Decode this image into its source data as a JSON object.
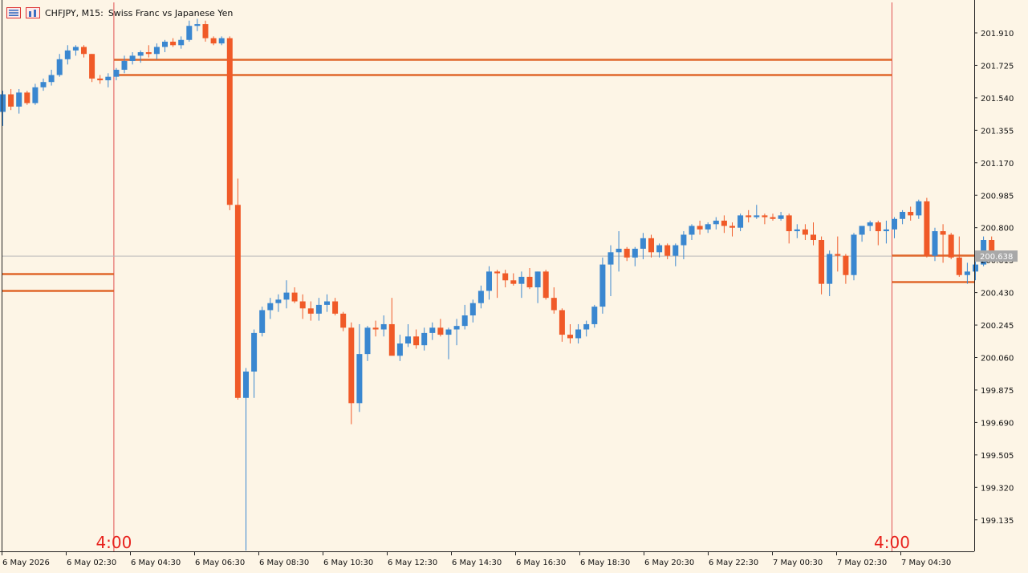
{
  "header": {
    "symbol": "CHFJPY, M15:",
    "description": "Swiss Franc vs Japanese Yen",
    "icons": [
      "menu-list-icon",
      "chart-bars-icon"
    ]
  },
  "chart_data": {
    "type": "candlestick",
    "symbol": "CHFJPY",
    "timeframe": "M15",
    "ylim": [
      199.0,
      202.1
    ],
    "y_ticks": [
      "201.910",
      "201.725",
      "201.540",
      "201.355",
      "201.170",
      "200.985",
      "200.800",
      "200.615",
      "200.430",
      "200.245",
      "200.060",
      "199.875",
      "199.690",
      "199.505",
      "199.320",
      "199.135"
    ],
    "x_ticks": [
      "6 May 2026",
      "6 May 02:30",
      "6 May 04:30",
      "6 May 06:30",
      "6 May 08:30",
      "6 May 10:30",
      "6 May 12:30",
      "6 May 14:30",
      "6 May 16:30",
      "6 May 18:30",
      "6 May 20:30",
      "6 May 22:30",
      "7 May 00:30",
      "7 May 02:30",
      "7 May 04:30"
    ],
    "current_price": "200.638",
    "session_markers": [
      {
        "label": "4:00",
        "bar_index": 14
      },
      {
        "label": "4:00",
        "bar_index": 110
      }
    ],
    "levels": [
      {
        "price": 201.76,
        "from_bar": 14,
        "to_bar": 110
      },
      {
        "price": 201.67,
        "from_bar": 14,
        "to_bar": 110
      },
      {
        "price": 200.54,
        "from_bar": 0,
        "to_bar": 14
      },
      {
        "price": 200.44,
        "from_bar": 0,
        "to_bar": 14
      },
      {
        "price": 200.645,
        "from_bar": 110,
        "to_bar": 121
      },
      {
        "price": 200.49,
        "from_bar": 110,
        "to_bar": 121
      }
    ],
    "colors": {
      "up": "#3a87d0",
      "down": "#f05a28",
      "level": "#e0662a",
      "session": "#e05050",
      "session_label": "#e8231e",
      "background": "#fdf5e6",
      "price_box": "#a8a8a8"
    },
    "candles": [
      [
        201.46,
        201.58,
        201.38,
        201.56
      ],
      [
        201.56,
        201.59,
        201.47,
        201.49
      ],
      [
        201.49,
        201.59,
        201.45,
        201.57
      ],
      [
        201.57,
        201.58,
        201.5,
        201.51
      ],
      [
        201.51,
        201.62,
        201.5,
        201.6
      ],
      [
        201.6,
        201.65,
        201.58,
        201.63
      ],
      [
        201.63,
        201.7,
        201.61,
        201.67
      ],
      [
        201.67,
        201.79,
        201.66,
        201.76
      ],
      [
        201.76,
        201.84,
        201.73,
        201.81
      ],
      [
        201.81,
        201.84,
        201.78,
        201.83
      ],
      [
        201.83,
        201.84,
        201.77,
        201.79
      ],
      [
        201.79,
        201.79,
        201.63,
        201.65
      ],
      [
        201.65,
        201.67,
        201.62,
        201.64
      ],
      [
        201.64,
        201.68,
        201.6,
        201.66
      ],
      [
        201.66,
        201.71,
        201.64,
        201.7
      ],
      [
        201.7,
        201.78,
        201.68,
        201.75
      ],
      [
        201.75,
        201.8,
        201.73,
        201.78
      ],
      [
        201.78,
        201.81,
        201.74,
        201.8
      ],
      [
        201.8,
        201.84,
        201.77,
        201.79
      ],
      [
        201.79,
        201.85,
        201.76,
        201.83
      ],
      [
        201.83,
        201.87,
        201.8,
        201.86
      ],
      [
        201.86,
        201.88,
        201.83,
        201.84
      ],
      [
        201.84,
        201.89,
        201.82,
        201.87
      ],
      [
        201.87,
        201.98,
        201.86,
        201.95
      ],
      [
        201.95,
        201.99,
        201.92,
        201.96
      ],
      [
        201.96,
        201.98,
        201.86,
        201.88
      ],
      [
        201.88,
        201.89,
        201.84,
        201.85
      ],
      [
        201.85,
        201.89,
        201.84,
        201.88
      ],
      [
        201.88,
        201.89,
        200.9,
        200.93
      ],
      [
        200.93,
        201.08,
        199.82,
        199.83
      ],
      [
        199.83,
        200.0,
        198.96,
        199.98
      ],
      [
        199.98,
        200.22,
        199.83,
        200.2
      ],
      [
        200.2,
        200.35,
        200.18,
        200.33
      ],
      [
        200.33,
        200.4,
        200.28,
        200.37
      ],
      [
        200.37,
        200.42,
        200.32,
        200.39
      ],
      [
        200.39,
        200.5,
        200.34,
        200.43
      ],
      [
        200.43,
        200.46,
        200.37,
        200.38
      ],
      [
        200.38,
        200.42,
        200.28,
        200.34
      ],
      [
        200.34,
        200.38,
        200.27,
        200.31
      ],
      [
        200.31,
        200.4,
        200.27,
        200.36
      ],
      [
        200.36,
        200.42,
        200.32,
        200.38
      ],
      [
        200.38,
        200.4,
        200.3,
        200.31
      ],
      [
        200.31,
        200.32,
        200.21,
        200.23
      ],
      [
        200.23,
        200.26,
        199.68,
        199.8
      ],
      [
        199.8,
        200.25,
        199.75,
        200.08
      ],
      [
        200.08,
        200.24,
        200.04,
        200.23
      ],
      [
        200.23,
        200.27,
        200.18,
        200.22
      ],
      [
        200.22,
        200.3,
        200.18,
        200.25
      ],
      [
        200.25,
        200.4,
        200.1,
        200.07
      ],
      [
        200.07,
        200.19,
        200.04,
        200.14
      ],
      [
        200.14,
        200.25,
        200.12,
        200.18
      ],
      [
        200.18,
        200.22,
        200.11,
        200.13
      ],
      [
        200.13,
        200.23,
        200.1,
        200.2
      ],
      [
        200.2,
        200.26,
        200.16,
        200.23
      ],
      [
        200.23,
        200.28,
        200.18,
        200.19
      ],
      [
        200.19,
        200.23,
        200.05,
        200.22
      ],
      [
        200.22,
        200.28,
        200.13,
        200.24
      ],
      [
        200.24,
        200.36,
        200.22,
        200.3
      ],
      [
        200.3,
        200.39,
        200.26,
        200.37
      ],
      [
        200.37,
        200.47,
        200.34,
        200.44
      ],
      [
        200.44,
        200.58,
        200.39,
        200.55
      ],
      [
        200.55,
        200.56,
        200.4,
        200.54
      ],
      [
        200.54,
        200.56,
        200.46,
        200.5
      ],
      [
        200.5,
        200.54,
        200.47,
        200.48
      ],
      [
        200.48,
        200.55,
        200.4,
        200.52
      ],
      [
        200.52,
        200.57,
        200.45,
        200.46
      ],
      [
        200.46,
        200.55,
        200.37,
        200.55
      ],
      [
        200.55,
        200.56,
        200.39,
        200.4
      ],
      [
        200.4,
        200.46,
        200.31,
        200.33
      ],
      [
        200.33,
        200.34,
        200.15,
        200.19
      ],
      [
        200.19,
        200.25,
        200.14,
        200.17
      ],
      [
        200.17,
        200.25,
        200.14,
        200.22
      ],
      [
        200.22,
        200.27,
        200.18,
        200.25
      ],
      [
        200.25,
        200.36,
        200.23,
        200.35
      ],
      [
        200.35,
        200.63,
        200.31,
        200.59
      ],
      [
        200.59,
        200.7,
        200.41,
        200.66
      ],
      [
        200.66,
        200.78,
        200.55,
        200.68
      ],
      [
        200.68,
        200.69,
        200.61,
        200.63
      ],
      [
        200.63,
        200.69,
        200.58,
        200.68
      ],
      [
        200.68,
        200.77,
        200.62,
        200.74
      ],
      [
        200.74,
        200.76,
        200.63,
        200.66
      ],
      [
        200.66,
        200.71,
        200.63,
        200.7
      ],
      [
        200.7,
        200.71,
        200.62,
        200.64
      ],
      [
        200.64,
        200.71,
        200.58,
        200.7
      ],
      [
        200.7,
        200.78,
        200.62,
        200.76
      ],
      [
        200.76,
        200.82,
        200.73,
        200.81
      ],
      [
        200.81,
        200.84,
        200.76,
        200.79
      ],
      [
        200.79,
        200.83,
        200.77,
        200.82
      ],
      [
        200.82,
        200.86,
        200.79,
        200.84
      ],
      [
        200.84,
        200.87,
        200.77,
        200.81
      ],
      [
        200.81,
        200.83,
        200.75,
        200.8
      ],
      [
        200.8,
        200.88,
        200.78,
        200.87
      ],
      [
        200.87,
        200.9,
        200.83,
        200.86
      ],
      [
        200.86,
        200.93,
        200.85,
        200.87
      ],
      [
        200.87,
        200.88,
        200.82,
        200.86
      ],
      [
        200.86,
        200.88,
        200.84,
        200.85
      ],
      [
        200.85,
        200.89,
        200.84,
        200.87
      ],
      [
        200.87,
        200.88,
        200.71,
        200.78
      ],
      [
        200.78,
        200.82,
        200.74,
        200.79
      ],
      [
        200.79,
        200.82,
        200.73,
        200.76
      ],
      [
        200.76,
        200.83,
        200.7,
        200.73
      ],
      [
        200.73,
        200.75,
        200.42,
        200.48
      ],
      [
        200.48,
        200.67,
        200.41,
        200.65
      ],
      [
        200.65,
        200.75,
        200.55,
        200.64
      ],
      [
        200.64,
        200.65,
        200.48,
        200.53
      ],
      [
        200.53,
        200.77,
        200.5,
        200.76
      ],
      [
        200.76,
        200.81,
        200.72,
        200.81
      ],
      [
        200.81,
        200.84,
        200.78,
        200.83
      ],
      [
        200.83,
        200.84,
        200.7,
        200.78
      ],
      [
        200.78,
        200.84,
        200.71,
        200.79
      ],
      [
        200.79,
        200.86,
        200.74,
        200.85
      ],
      [
        200.85,
        200.9,
        200.82,
        200.89
      ],
      [
        200.89,
        200.92,
        200.84,
        200.87
      ],
      [
        200.87,
        200.96,
        200.85,
        200.95
      ],
      [
        200.95,
        200.97,
        200.63,
        200.64
      ],
      [
        200.64,
        200.8,
        200.61,
        200.78
      ],
      [
        200.78,
        200.82,
        200.6,
        200.76
      ],
      [
        200.76,
        200.77,
        200.62,
        200.63
      ],
      [
        200.63,
        200.75,
        200.52,
        200.53
      ],
      [
        200.53,
        200.6,
        200.48,
        200.55
      ],
      [
        200.55,
        200.62,
        200.5,
        200.59
      ],
      [
        200.59,
        200.75,
        200.58,
        200.73
      ],
      [
        200.73,
        200.75,
        200.61,
        200.63
      ]
    ]
  }
}
